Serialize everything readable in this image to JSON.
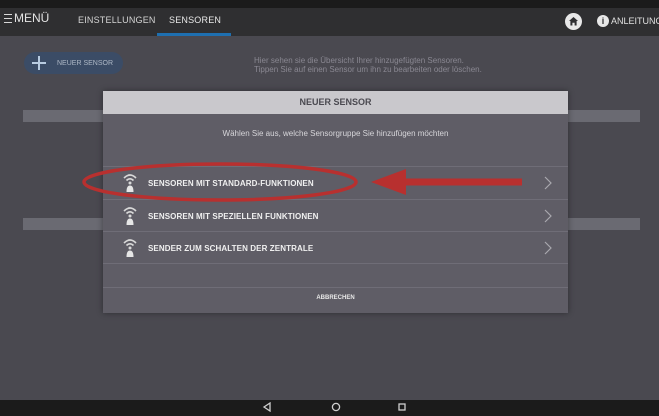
{
  "topbar": {
    "menu_label": "MENÜ",
    "tabs": [
      {
        "label": "EINSTELLUNGEN"
      },
      {
        "label": "SENSOREN"
      }
    ],
    "help_label": "ANLEITUNG"
  },
  "main": {
    "new_sensor_label": "NEUER SENSOR",
    "hint_line1": "Hier sehen sie die Übersicht Ihrer hinzugefügten Sensoren.",
    "hint_line2": "Tippen Sie auf einen Sensor um ihn zu bearbeiten oder löschen."
  },
  "dialog": {
    "title": "NEUER SENSOR",
    "subtitle": "Wählen Sie aus, welche Sensorgruppe Sie hinzufügen möchten",
    "options": [
      {
        "label": "SENSOREN MIT STANDARD-FUNKTIONEN",
        "icon": "wireless-sensor-icon"
      },
      {
        "label": "SENSOREN MIT SPEZIELLEN FUNKTIONEN",
        "icon": "wireless-sensor-icon"
      },
      {
        "label": "SENDER ZUM SCHALTEN DER ZENTRALE",
        "icon": "wireless-sensor-icon"
      }
    ],
    "cancel_label": "ABBRECHEN"
  },
  "colors": {
    "tab_underline": "#1e6fb0",
    "annotation": "#b8302f",
    "dialog_header": "#c9c8cc"
  }
}
